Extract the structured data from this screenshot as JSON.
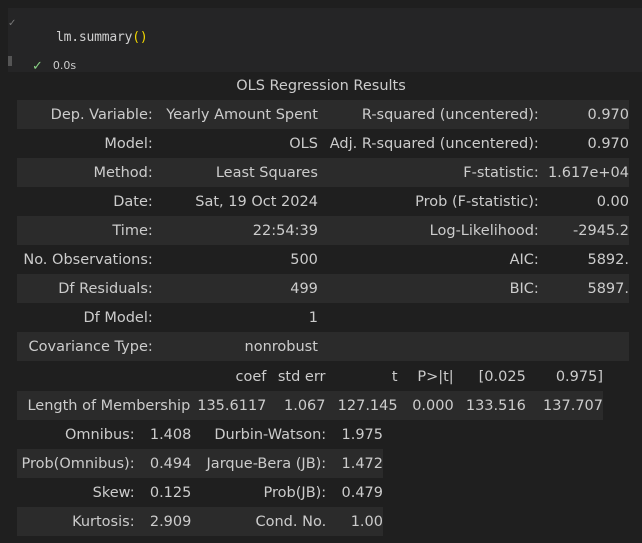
{
  "cell": {
    "code_name": "lm.summary",
    "code_parens": "()",
    "status_time": "0.0s"
  },
  "summary": {
    "title": "OLS Regression Results",
    "top_rows": [
      [
        "Dep. Variable:",
        "Yearly Amount Spent",
        "R-squared (uncentered):",
        "0.970"
      ],
      [
        "Model:",
        "OLS",
        "Adj. R-squared (uncentered):",
        "0.970"
      ],
      [
        "Method:",
        "Least Squares",
        "F-statistic:",
        "1.617e+04"
      ],
      [
        "Date:",
        "Sat, 19 Oct 2024",
        "Prob (F-statistic):",
        "0.00"
      ],
      [
        "Time:",
        "22:54:39",
        "Log-Likelihood:",
        "-2945.2"
      ],
      [
        "No. Observations:",
        "500",
        "AIC:",
        "5892."
      ],
      [
        "Df Residuals:",
        "499",
        "BIC:",
        "5897."
      ],
      [
        "Df Model:",
        "1",
        "",
        ""
      ],
      [
        "Covariance Type:",
        "nonrobust",
        "",
        ""
      ]
    ],
    "coef_headers": [
      "",
      "coef",
      "std err",
      "t",
      "P>|t|",
      "[0.025",
      "0.975]"
    ],
    "coef_rows": [
      [
        "Length of Membership",
        "135.6117",
        "1.067",
        "127.145",
        "0.000",
        "133.516",
        "137.707"
      ]
    ],
    "diag_rows": [
      [
        "Omnibus:",
        "1.408",
        "Durbin-Watson:",
        "1.975"
      ],
      [
        "Prob(Omnibus):",
        "0.494",
        "Jarque-Bera (JB):",
        "1.472"
      ],
      [
        "Skew:",
        "0.125",
        "Prob(JB):",
        "0.479"
      ],
      [
        "Kurtosis:",
        "2.909",
        "Cond. No.",
        "1.00"
      ]
    ]
  }
}
